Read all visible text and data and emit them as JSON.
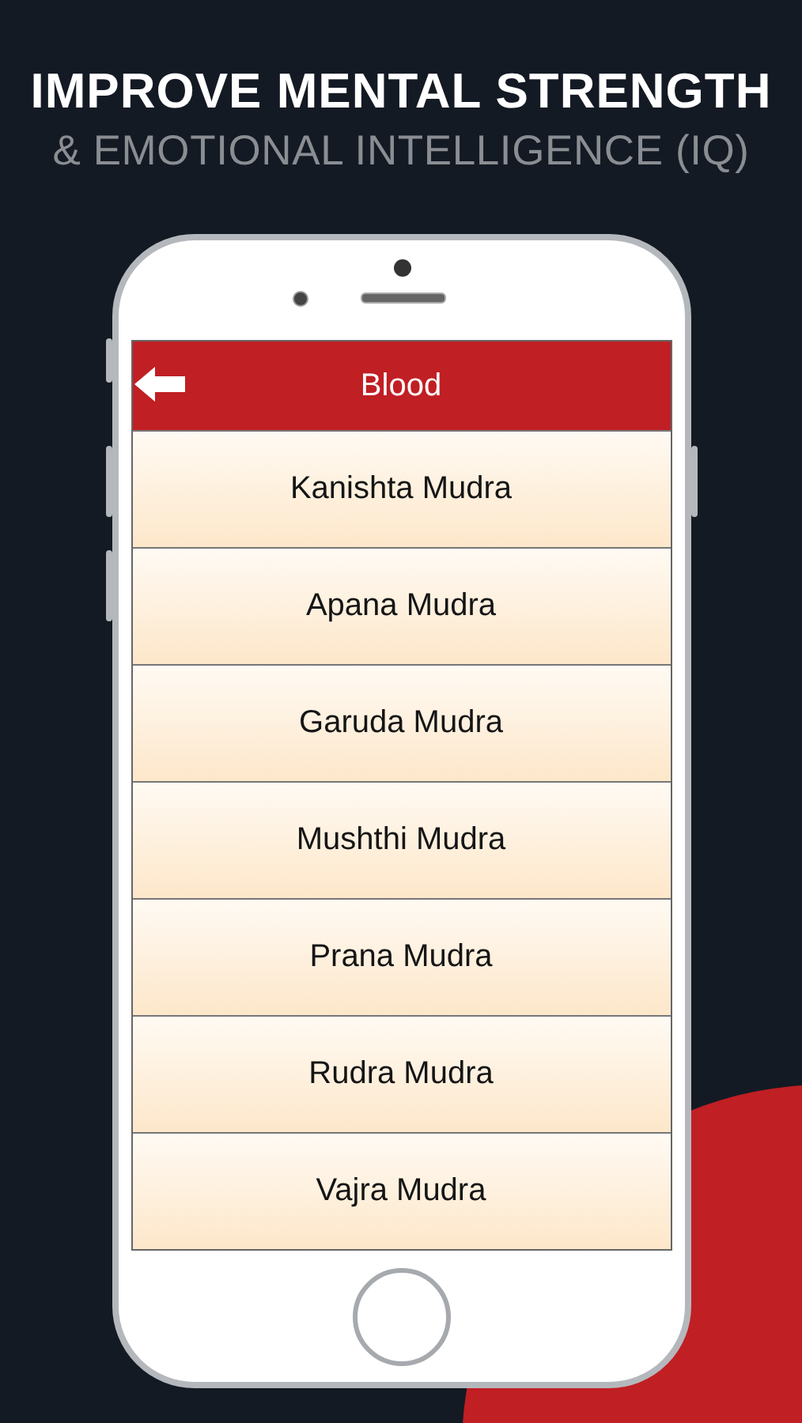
{
  "headline": "IMPROVE MENTAL STRENGTH",
  "subheadline": "& EMOTIONAL INTELLIGENCE (IQ)",
  "screen": {
    "title": "Blood",
    "items": [
      "Kanishta Mudra",
      "Apana Mudra",
      "Garuda Mudra",
      "Mushthi Mudra",
      "Prana Mudra",
      "Rudra Mudra",
      "Vajra Mudra"
    ]
  }
}
